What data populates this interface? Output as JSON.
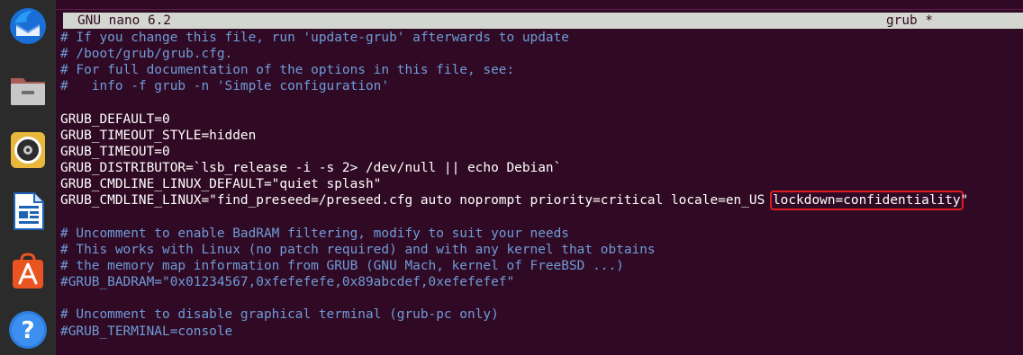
{
  "dock": {
    "items": [
      {
        "name": "thunderbird-icon"
      },
      {
        "name": "files-icon"
      },
      {
        "name": "rhythmbox-icon"
      },
      {
        "name": "libreoffice-writer-icon"
      },
      {
        "name": "software-center-icon"
      },
      {
        "name": "help-icon"
      }
    ]
  },
  "titlebar": {
    "app": "GNU nano 6.2",
    "file": "grub *"
  },
  "editor": {
    "lines": [
      {
        "text": "# If you change this file, run 'update-grub' afterwards to update",
        "kind": "comment"
      },
      {
        "text": "# /boot/grub/grub.cfg.",
        "kind": "comment"
      },
      {
        "text": "# For full documentation of the options in this file, see:",
        "kind": "comment"
      },
      {
        "text": "#   info -f grub -n 'Simple configuration'",
        "kind": "comment"
      },
      {
        "text": "",
        "kind": "plain"
      },
      {
        "text": "GRUB_DEFAULT=0",
        "kind": "plain"
      },
      {
        "text": "GRUB_TIMEOUT_STYLE=hidden",
        "kind": "plain"
      },
      {
        "text": "GRUB_TIMEOUT=0",
        "kind": "plain"
      },
      {
        "text": "GRUB_DISTRIBUTOR=`lsb_release -i -s 2> /dev/null || echo Debian`",
        "kind": "plain"
      },
      {
        "text": "GRUB_CMDLINE_LINUX_DEFAULT=\"quiet splash\"",
        "kind": "plain"
      },
      {
        "text": "",
        "kind": "cmdline"
      },
      {
        "text": "",
        "kind": "plain"
      },
      {
        "text": "# Uncomment to enable BadRAM filtering, modify to suit your needs",
        "kind": "comment"
      },
      {
        "text": "# This works with Linux (no patch required) and with any kernel that obtains",
        "kind": "comment"
      },
      {
        "text": "# the memory map information from GRUB (GNU Mach, kernel of FreeBSD ...)",
        "kind": "comment"
      },
      {
        "text": "#GRUB_BADRAM=\"0x01234567,0xfefefefe,0x89abcdef,0xefefefef\"",
        "kind": "comment"
      },
      {
        "text": "",
        "kind": "plain"
      },
      {
        "text": "# Uncomment to disable graphical terminal (grub-pc only)",
        "kind": "comment"
      },
      {
        "text": "#GRUB_TERMINAL=console",
        "kind": "comment"
      }
    ],
    "cmdline": {
      "before": "GRUB_CMDLINE_LINUX=\"find_preseed=/preseed.cfg auto noprompt priority=critical locale=en_US ",
      "highlight": "lockdown=confidentiality",
      "after": "\""
    }
  },
  "colors": {
    "background": "#300a24",
    "comment": "#6f9bd8",
    "text": "#ffffff",
    "titlebar": "#d3d7cf",
    "highlight_box": "#e01b24"
  }
}
